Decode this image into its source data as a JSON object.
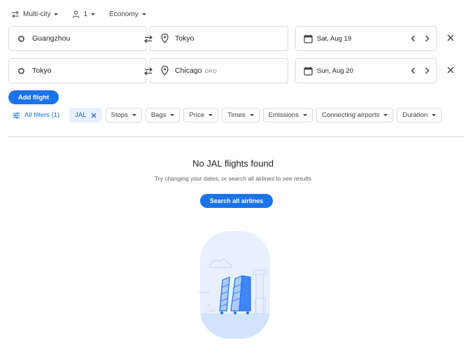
{
  "topbar": {
    "trip_type": "Multi-city",
    "passengers": "1",
    "cabin": "Economy"
  },
  "legs": [
    {
      "origin": "Guangzhou",
      "destination": "Tokyo",
      "destination_code": "",
      "date": "Sat, Aug 19"
    },
    {
      "origin": "Tokyo",
      "destination": "Chicago",
      "destination_code": "ORD",
      "date": "Sun, Aug 20"
    }
  ],
  "add_flight_label": "Add flight",
  "filters": {
    "all_filters_label": "All filters (1)",
    "airline_chip": "JAL",
    "chips": [
      "Stops",
      "Bags",
      "Price",
      "Times",
      "Emissions",
      "Connecting airports",
      "Duration"
    ]
  },
  "results": {
    "title": "No JAL flights found",
    "subtitle": "Try changing your dates, or search all airlines to see results",
    "search_all_label": "Search all airlines"
  },
  "colors": {
    "accent": "#1a73e8",
    "chip_active_bg": "#e8f0fe",
    "border": "#dadce0"
  },
  "icons": [
    "swap-arrows-icon",
    "person-icon",
    "caret-down-icon",
    "origin-ring-icon",
    "location-pin-icon",
    "calendar-icon",
    "chevron-left-icon",
    "chevron-right-icon",
    "close-icon",
    "tune-icon"
  ]
}
